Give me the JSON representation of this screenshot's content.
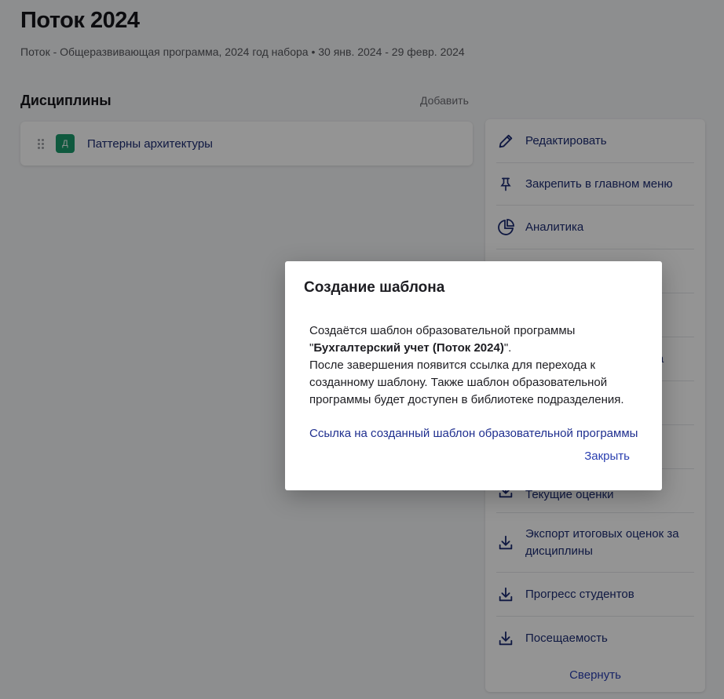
{
  "page": {
    "title": "Поток 2024",
    "subtitle": "Поток - Общеразвивающая программа, 2024 год набора • 30 янв. 2024 - 29 февр. 2024"
  },
  "disciplines": {
    "title": "Дисциплины",
    "add_label": "Добавить",
    "items": [
      {
        "badge": "Д",
        "name": "Паттерны архитектуры"
      }
    ]
  },
  "actions": {
    "items": [
      {
        "icon": "pencil-icon",
        "label": "Редактировать"
      },
      {
        "icon": "pin-icon",
        "label": "Закрепить в главном меню"
      },
      {
        "icon": "pie-chart-icon",
        "label": "Аналитика"
      },
      {
        "icon": "",
        "label": ""
      },
      {
        "icon": "",
        "label": ""
      },
      {
        "icon": "",
        "label": "ка"
      },
      {
        "icon": "",
        "label": ""
      },
      {
        "icon": "",
        "label": ""
      },
      {
        "icon": "download-icon",
        "label": "Текущие оценки"
      },
      {
        "icon": "download-icon",
        "label": "Экспорт итоговых оценок за дисциплины"
      },
      {
        "icon": "download-icon",
        "label": "Прогресс студентов"
      },
      {
        "icon": "download-icon",
        "label": "Посещаемость"
      }
    ],
    "collapse_label": "Свернуть"
  },
  "modal": {
    "title": "Создание шаблона",
    "body_line1": "Создаётся шаблон образовательной программы",
    "body_quote_open": "\"",
    "program_name": "Бухгалтерский учет (Поток 2024)",
    "body_quote_close": "\".",
    "body_rest": "После завершения появится ссылка для перехода к созданному шаблону. Также шаблон образовательной программы будет доступен в библиотеке подразделения.",
    "link_label": "Ссылка на созданный шаблон образовательной программы",
    "close_label": "Закрыть"
  },
  "colors": {
    "accent": "#2a3fb0",
    "link_dark": "#1c2c73",
    "badge": "#1b9a6c",
    "overlay": "rgba(0,0,0,0.42)"
  }
}
